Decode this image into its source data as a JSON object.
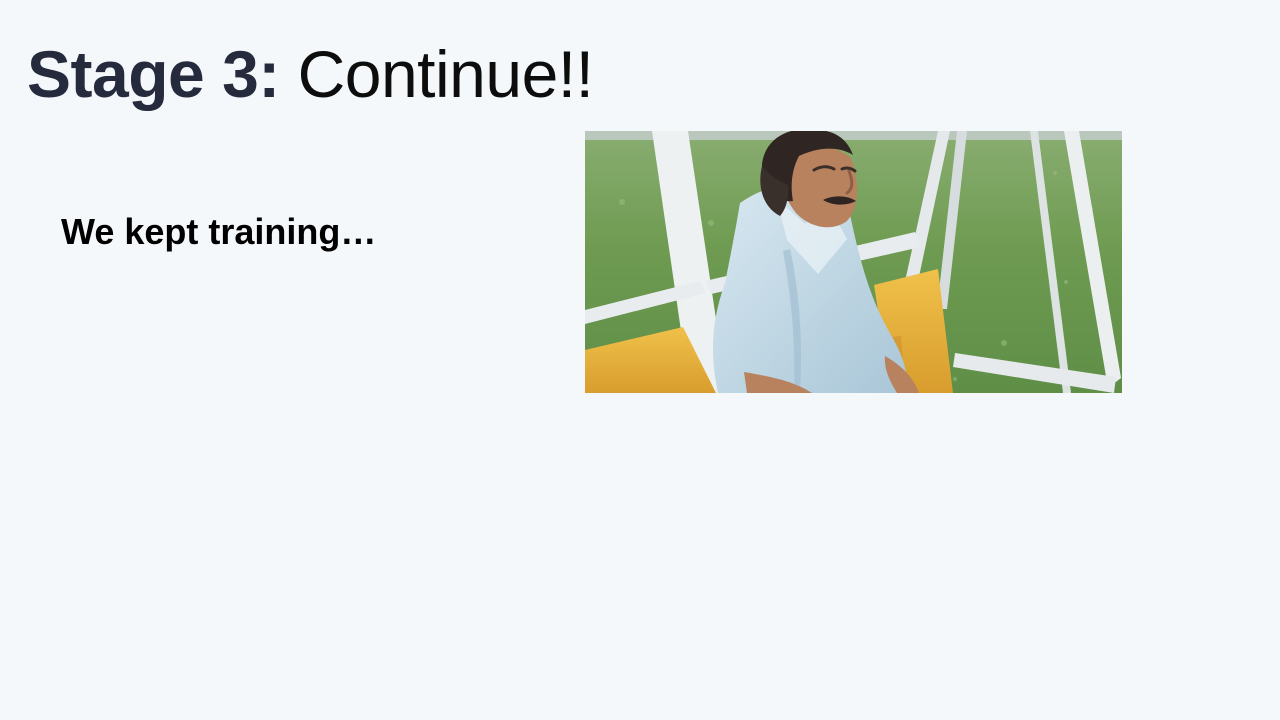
{
  "slide": {
    "title_prefix": "Stage 3:",
    "title_main": "Continue!!",
    "body_text": "We kept training…"
  },
  "photo": {
    "colors": {
      "grass": "#6e9b51",
      "cushion": "#e5b13d",
      "frame": "#e8ecee",
      "shirt": "#c9dde8",
      "skin": "#b8825f",
      "hair": "#2f2623"
    }
  }
}
